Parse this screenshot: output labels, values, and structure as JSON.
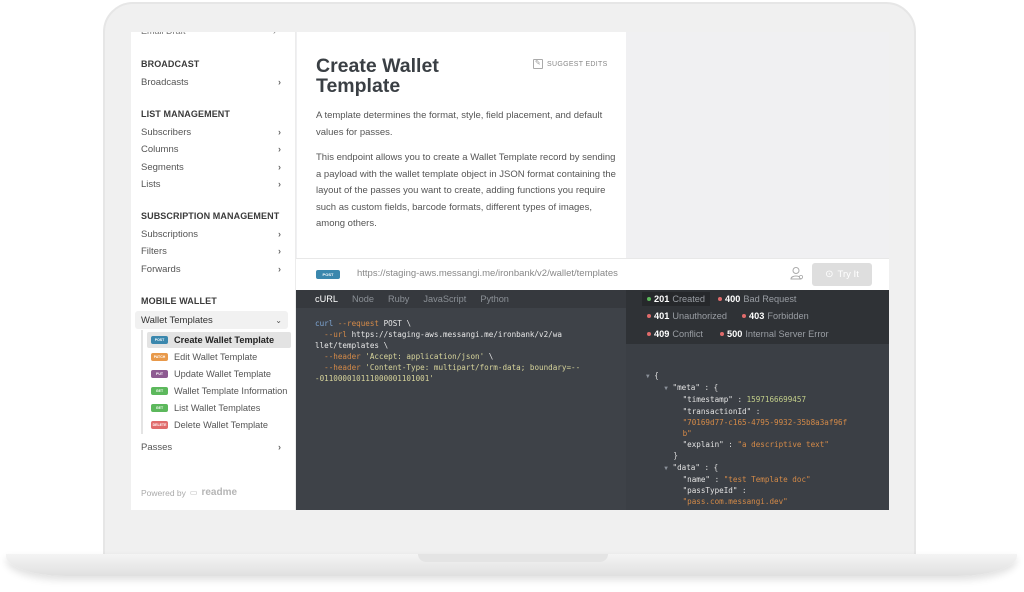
{
  "sidebar": {
    "cut_item": "Email Draft",
    "sections": [
      {
        "title": "BROADCAST",
        "items": [
          "Broadcasts"
        ]
      },
      {
        "title": "LIST MANAGEMENT",
        "items": [
          "Subscribers",
          "Columns",
          "Segments",
          "Lists"
        ]
      },
      {
        "title": "SUBSCRIPTION MANAGEMENT",
        "items": [
          "Subscriptions",
          "Filters",
          "Forwards"
        ]
      },
      {
        "title": "MOBILE WALLET",
        "items": []
      }
    ],
    "group": {
      "label": "Wallet Templates",
      "expanded": true
    },
    "endpoints": [
      {
        "method": "POST",
        "label": "Create Wallet Template",
        "color": "#3a87ad",
        "active": true
      },
      {
        "method": "PATCH",
        "label": "Edit Wallet Template",
        "color": "#e8994a",
        "active": false
      },
      {
        "method": "PUT",
        "label": "Update Wallet Template",
        "color": "#8d5a91",
        "active": false
      },
      {
        "method": "GET",
        "label": "Wallet Template Information",
        "color": "#5cb85c",
        "active": false
      },
      {
        "method": "GET",
        "label": "List Wallet Templates",
        "color": "#5cb85c",
        "active": false
      },
      {
        "method": "DELETE",
        "label": "Delete Wallet Template",
        "color": "#e06b6b",
        "active": false
      }
    ],
    "passes": "Passes",
    "powered_by": "Powered by",
    "powered_logo": "readme"
  },
  "doc": {
    "title": "Create Wallet Template",
    "suggest_edits": "SUGGEST EDITS",
    "paragraph1": "A template determines the format, style, field placement, and default values for passes.",
    "paragraph2": "This endpoint allows you to create a Wallet Template record by sending a payload with the wallet template object in JSON format containing the layout of the passes you want to create, adding functions you require such as custom fields, barcode formats, different types of images, among others."
  },
  "request": {
    "method": "POST",
    "url": "https://staging-aws.messangi.me/ironbank/v2/wallet/templates",
    "try_label": "Try It"
  },
  "code": {
    "tabs": [
      "cURL",
      "Node",
      "Ruby",
      "JavaScript",
      "Python"
    ],
    "active_tab": "cURL",
    "lines": [
      [
        "curl ",
        "--request",
        " POST \\"
      ],
      [
        "  --url",
        " https://staging-aws.messangi.me/ironbank/v2/wa"
      ],
      [
        "llet/templates \\"
      ],
      [
        "  --header",
        " 'Accept: application/json'",
        " \\"
      ],
      [
        "  --header",
        " 'Content-Type: multipart/form-data; boundary=--"
      ],
      [
        "-011000010111000001101001'"
      ]
    ]
  },
  "response": {
    "statuses": [
      {
        "code": "201",
        "label": "Created",
        "color": "#5cb85c",
        "active": true
      },
      {
        "code": "400",
        "label": "Bad Request",
        "color": "#e06b6b",
        "active": false
      },
      {
        "code": "401",
        "label": "Unauthorized",
        "color": "#e06b6b",
        "active": false
      },
      {
        "code": "403",
        "label": "Forbidden",
        "color": "#e06b6b",
        "active": false
      },
      {
        "code": "409",
        "label": "Conflict",
        "color": "#e06b6b",
        "active": false
      },
      {
        "code": "500",
        "label": "Internal Server Error",
        "color": "#e06b6b",
        "active": false
      }
    ],
    "json": {
      "meta_key": "\"meta\"",
      "timestamp_key": "\"timestamp\"",
      "timestamp_val": "1597166699457",
      "transaction_key": "\"transactionId\"",
      "transaction_val_1": "\"70169d77-c165-4795-9932-35b8a3af96f",
      "transaction_val_2": "b\"",
      "explain_key": "\"explain\"",
      "explain_val": "\"a descriptive text\"",
      "data_key": "\"data\"",
      "name_key": "\"name\"",
      "name_val": "\"test Template doc\"",
      "passtype_key": "\"passTypeId\"",
      "passtype_val": "\"pass.com.messangi.dev\""
    }
  }
}
